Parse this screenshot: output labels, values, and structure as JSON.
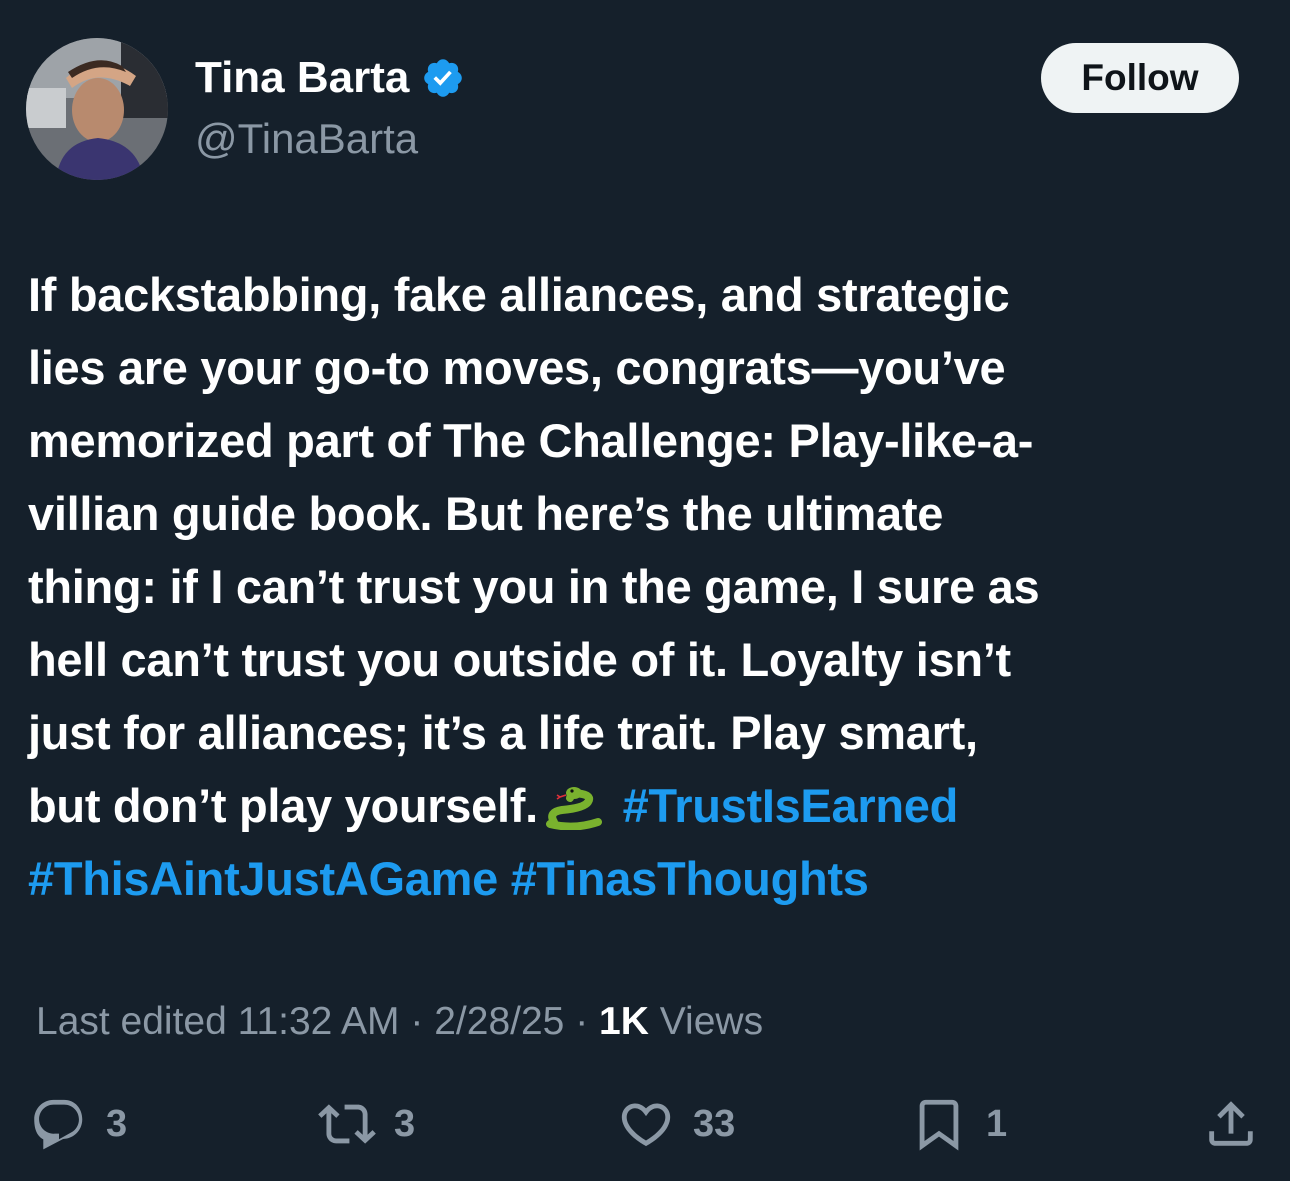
{
  "author": {
    "display_name": "Tina Barta",
    "handle": "@TinaBarta",
    "verified": true,
    "avatar_icon": "profile-photo"
  },
  "follow_label": "Follow",
  "tweet": {
    "lines": [
      "If backstabbing, fake alliances, and strategic",
      "lies are your go-to moves, congrats—you’ve",
      "memorized part of The Challenge: Play-like-a-",
      "villian guide book.  But here’s the ultimate",
      "thing: if I can’t trust you in the game, I sure as",
      "hell can’t trust you outside of it.  Loyalty isn’t",
      "just for alliances; it’s a life trait.  Play smart,"
    ],
    "last_line_text": "but don’t play yourself.",
    "emoji": "snake",
    "hashtags": [
      "#TrustIsEarned",
      "#ThisAintJustAGame",
      "#TinasThoughts"
    ]
  },
  "meta": {
    "edited_label": "Last edited",
    "time": "11:32 AM",
    "date": "2/28/25",
    "views_count": "1K",
    "views_label": "Views",
    "separator": "·"
  },
  "actions": {
    "replies": "3",
    "reposts": "3",
    "likes": "33",
    "bookmarks": "1"
  },
  "colors": {
    "background": "#15202b",
    "text": "#ffffff",
    "secondary": "#8b98a5",
    "accent": "#1d9bf0",
    "follow_bg": "#eff3f4"
  }
}
